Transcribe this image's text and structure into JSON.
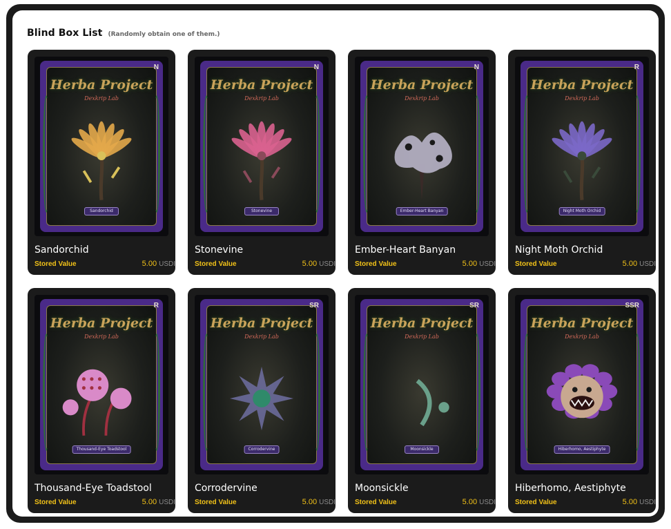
{
  "header": {
    "title": "Blind Box List",
    "subtitle": "(Randomly obtain one of them.)"
  },
  "cards": [
    {
      "name": "Sandorchid",
      "rarity": "N",
      "plate": "Sandorchid",
      "stored_label": "Stored Value",
      "price": "5.00",
      "unit": "USDI",
      "color": "#e3a94a",
      "accent": "#d9c15a",
      "shape": "flower"
    },
    {
      "name": "Stonevine",
      "rarity": "N",
      "plate": "Stonevine",
      "stored_label": "Stored Value",
      "price": "5.00",
      "unit": "USDI",
      "color": "#d9628f",
      "accent": "#8a4a5a",
      "shape": "flower"
    },
    {
      "name": "Ember-Heart Banyan",
      "rarity": "N",
      "plate": "Ember-Heart Banyan",
      "stored_label": "Stored Value",
      "price": "5.00",
      "unit": "USDI",
      "color": "#b8b4c8",
      "accent": "#6a5a7a",
      "shape": "tree"
    },
    {
      "name": "Night Moth Orchid",
      "rarity": "R",
      "plate": "Night Moth Orchid",
      "stored_label": "Stored Value",
      "price": "5.00",
      "unit": "USDI",
      "color": "#7b68c8",
      "accent": "#3a4a3a",
      "shape": "flower"
    },
    {
      "name": "Thousand-Eye Toadstool",
      "rarity": "R",
      "plate": "Thousand-Eye Toadstool",
      "stored_label": "Stored Value",
      "price": "5.00",
      "unit": "USDI",
      "color": "#d98ac8",
      "accent": "#a03040",
      "shape": "mushroom"
    },
    {
      "name": "Corrodervine",
      "rarity": "SR",
      "plate": "Corrodervine",
      "stored_label": "Stored Value",
      "price": "5.00",
      "unit": "USDI",
      "color": "#6a6a9a",
      "accent": "#2f8a6a",
      "shape": "spiky"
    },
    {
      "name": "Moonsickle",
      "rarity": "SR",
      "plate": "Moonsickle",
      "stored_label": "Stored Value",
      "price": "5.00",
      "unit": "USDI",
      "color": "#6aa08a",
      "accent": "#c9a35a",
      "shape": "moon"
    },
    {
      "name": "Hiberhomo, Aestiphyte",
      "rarity": "SSR",
      "plate": "Hiberhomo, Aestiphyte",
      "stored_label": "Stored Value",
      "price": "5.00",
      "unit": "USDI",
      "color": "#8a4ab8",
      "accent": "#c8a890",
      "shape": "monster"
    }
  ],
  "artwork": {
    "brand": "Herba Project",
    "brand_sub": "Dexkrip Lab"
  }
}
